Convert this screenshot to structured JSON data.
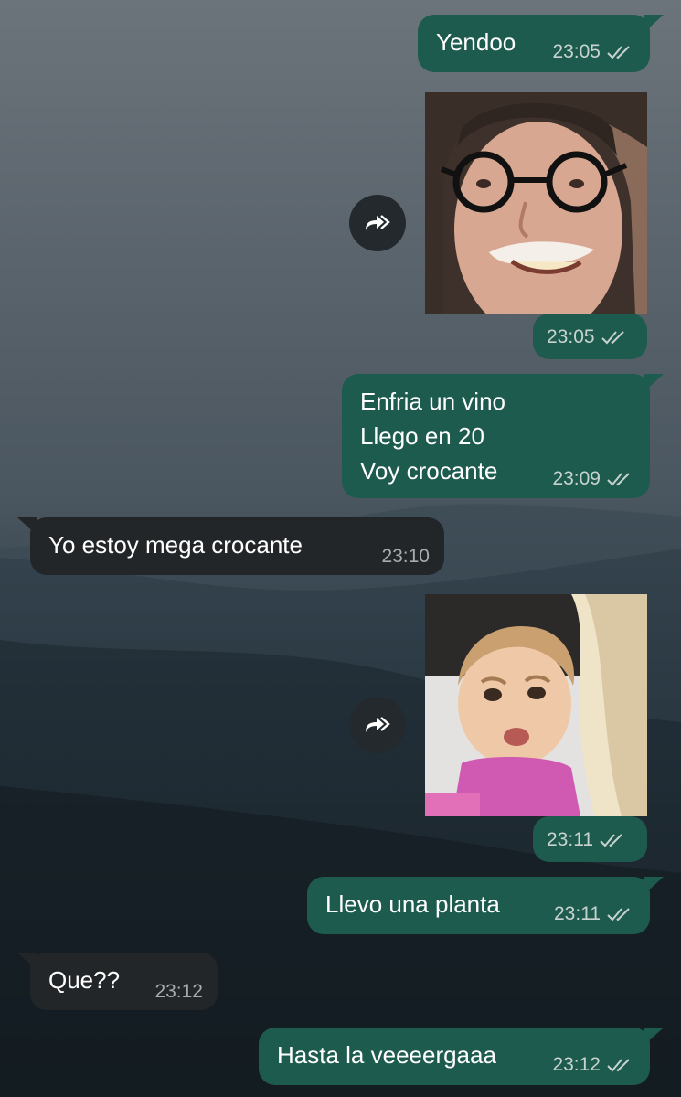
{
  "colors": {
    "outgoing_bubble": "#1e5b4f",
    "incoming_bubble": "#232628",
    "read_ticks": "#c8d3cf",
    "text": "#ffffff"
  },
  "messages": [
    {
      "type": "outgoing_text",
      "text": "Yendoo",
      "time": "23:05",
      "status": "read"
    },
    {
      "type": "outgoing_sticker",
      "sticker": "man-with-glasses-sticker",
      "time": "23:05",
      "status": "read"
    },
    {
      "type": "outgoing_text",
      "lines": [
        "Enfria un vino",
        "Llego en 20",
        "Voy crocante"
      ],
      "time": "23:09",
      "status": "read"
    },
    {
      "type": "incoming_text",
      "text": "Yo estoy mega crocante",
      "time": "23:10"
    },
    {
      "type": "outgoing_sticker",
      "sticker": "toddler-face-sticker",
      "time": "23:11",
      "status": "read"
    },
    {
      "type": "outgoing_text",
      "text": "Llevo una planta",
      "time": "23:11",
      "status": "read"
    },
    {
      "type": "incoming_text",
      "text": "Que??",
      "time": "23:12"
    },
    {
      "type": "outgoing_text",
      "text": "Hasta la veeeergaaa",
      "time": "23:12",
      "status": "read"
    }
  ],
  "icons": {
    "forward": "forward-icon",
    "read_status": "double-check-icon"
  }
}
